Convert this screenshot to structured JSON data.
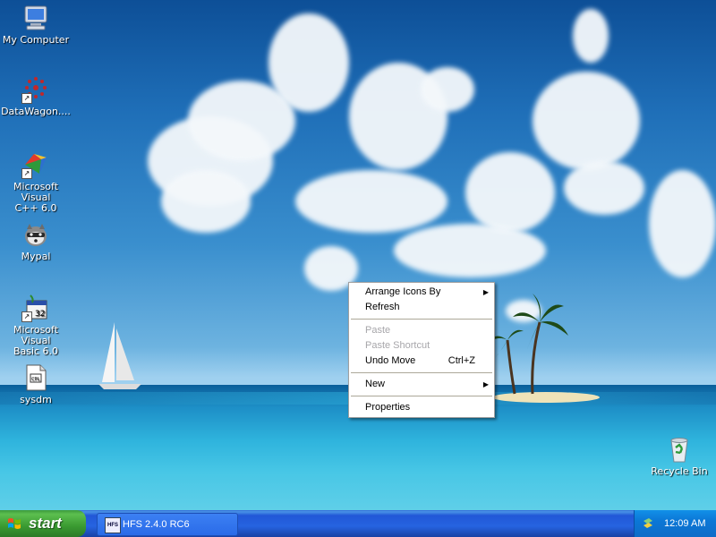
{
  "desktop": {
    "icons": [
      {
        "label": "My Computer",
        "icon": "my-computer-icon"
      },
      {
        "label": "DataWagon....",
        "icon": "datawagon-icon"
      },
      {
        "label_line1": "Microsoft Visual",
        "label_line2": "C++ 6.0",
        "icon": "visual-cpp-icon"
      },
      {
        "label": "Mypal",
        "icon": "mypal-icon"
      },
      {
        "label_line1": "Microsoft Visual",
        "label_line2": "Basic 6.0",
        "icon": "visual-basic-icon"
      },
      {
        "label": "sysdm",
        "icon": "sysdm-file-icon"
      },
      {
        "label": "Recycle Bin",
        "icon": "recycle-bin-icon"
      }
    ]
  },
  "context_menu": {
    "items": [
      {
        "label": "Arrange Icons By",
        "submenu": true
      },
      {
        "label": "Refresh"
      },
      {
        "label": "Paste",
        "disabled": true
      },
      {
        "label": "Paste Shortcut",
        "disabled": true
      },
      {
        "label": "Undo Move",
        "shortcut": "Ctrl+Z"
      },
      {
        "label": "New",
        "submenu": true
      },
      {
        "label": "Properties"
      }
    ],
    "submenu_arrow": "▶"
  },
  "taskbar": {
    "start_label": "start",
    "tasks": [
      {
        "label": "HFS 2.4.0 RC6",
        "icon_text": "HFS"
      }
    ],
    "clock": "12:09 AM"
  },
  "colors": {
    "taskbar_blue": "#2663e0",
    "start_green": "#3a9a31",
    "tray_blue": "#0b77d6",
    "menu_disabled": "#a7a6aa"
  }
}
